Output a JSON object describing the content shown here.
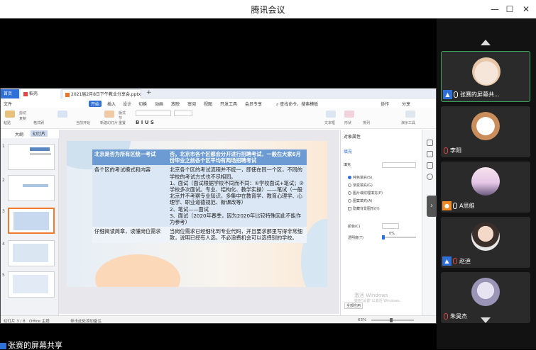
{
  "window": {
    "title": "腾讯会议"
  },
  "app": {
    "tabs": {
      "home": "首页",
      "docer": "稻壳",
      "file": "2021届2月8日下午教业分享会.pptx"
    },
    "menu": [
      "文件",
      "开始",
      "插入",
      "设计",
      "切换",
      "动画",
      "放映",
      "审阅",
      "视图",
      "开发工具",
      "会员专享"
    ],
    "menu_active": "开始",
    "search_placeholder": "查找命令、搜索模板",
    "right_menu": [
      "协作",
      "分享"
    ],
    "pane_tabs": [
      "大纲",
      "幻灯片"
    ],
    "ribbon_labels": [
      "粘贴",
      "剪切",
      "复制",
      "格式刷",
      "当前开始",
      "新建幻灯片",
      "版式",
      "节",
      "重置",
      "文本框",
      "形状",
      "排列",
      "演示工具"
    ],
    "slide_count": [
      "1",
      "2",
      "3",
      "4",
      "5"
    ],
    "right_panel": {
      "title": "对象属性",
      "tab": "填充",
      "section": "填充",
      "options": [
        "纯色填充(S)",
        "渐变填充(G)",
        "图片或纹理填充(P)",
        "图案填充(A)",
        "隐藏背景图形(H)"
      ],
      "color_label": "颜色(C)",
      "transparency_label": "透明度(T)",
      "transparency_value": "0%",
      "apply_all": "全部应用"
    },
    "status": {
      "slide_info": "幻灯片 3 / 8",
      "theme": "Office 主题",
      "notes": "单击此处添加备注",
      "zoom": "63%"
    },
    "watermark": [
      "激活 Windows",
      "转到\"设置\"以激活 Windows。"
    ]
  },
  "slide": {
    "table": [
      {
        "q": "北京是否为所有区统一考试",
        "a": "否。北京市各个区都会分开进行招聘考试，一般在大家6月份毕业之前各个区平均有两场招聘考试"
      },
      {
        "q": "各个区的考试模式和内容",
        "a": "北京各个区的考试流程并不统一，即使在同一个区，不同的学校的考试方式也不尽相同。\n1、面试（面试根据学校不同而不同：①学校面试+笔试；②学校多次面试。专业、结构化、教学实操）——笔试（一般北京并不考察专业知识，多集中在教育学、教育心理学、心理学、职业道德规范、新课改等）\n2、笔试——面试\n3、面试（2020年春季，因为2020年比较特殊因此不能作为参考）"
      },
      {
        "q": "仔细阅读简章，读懂岗位需求",
        "a": "当岗位需求已经细化到专业代码，并且要求那里写得非常细致，说明已经有人选，不必浪费机会可以选择别的学校。"
      }
    ]
  },
  "participants": [
    {
      "name": "张赛的屏幕共...",
      "tag": "blue",
      "muted": false
    },
    {
      "name": "李阳",
      "tag": "none",
      "muted": true
    },
    {
      "name": "A思维",
      "tag": "orange",
      "muted": false
    },
    {
      "name": "赵迪",
      "tag": "blue",
      "muted": true
    },
    {
      "name": "朱昊杰",
      "tag": "none",
      "muted": true
    }
  ],
  "bottom_share": "张赛的屏幕共享"
}
